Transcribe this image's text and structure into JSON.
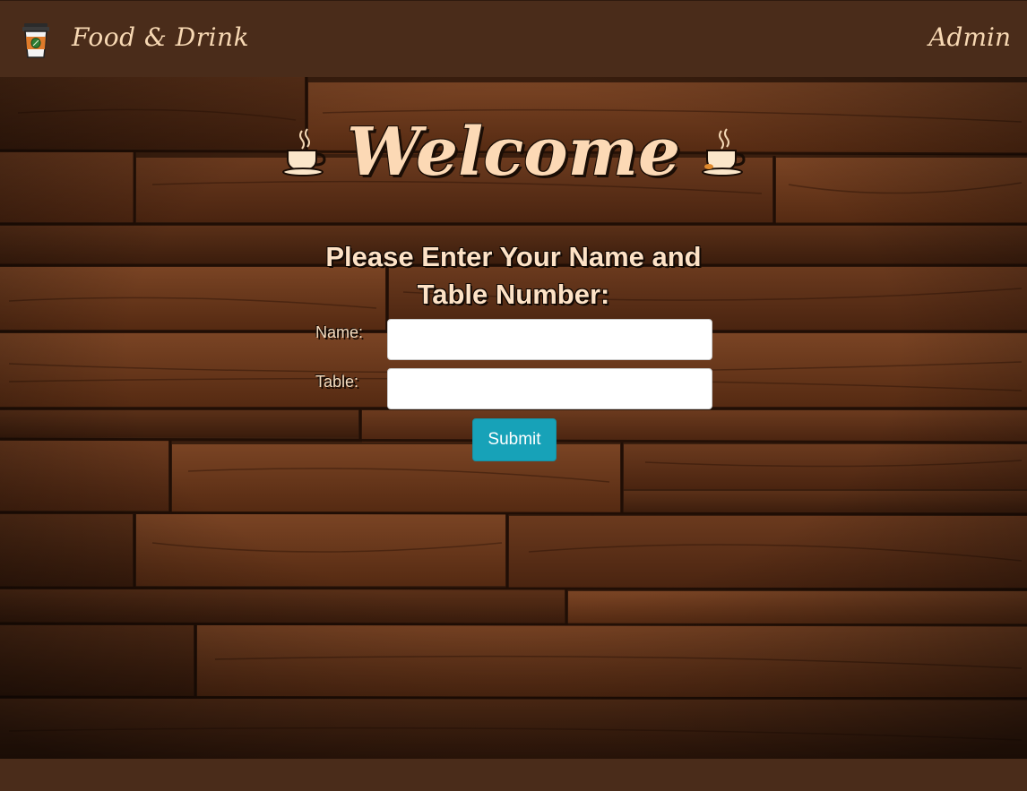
{
  "nav": {
    "brand": "Food & Drink",
    "admin_link": "Admin",
    "brand_icon": "coffee-cup-icon"
  },
  "hero": {
    "title": "Welcome",
    "left_icon": "coffee-cup-icon",
    "right_icon": "coffee-cup-icon"
  },
  "form": {
    "prompt_line1": "Please Enter Your Name and",
    "prompt_line2": "Table Number:",
    "name_label": "Name:",
    "name_value": "",
    "table_label": "Table:",
    "table_value": "",
    "submit_label": "Submit"
  },
  "colors": {
    "navbar": "#4a2c1a",
    "title_text": "#fcd9b5",
    "submit_button": "#17a2b8"
  }
}
